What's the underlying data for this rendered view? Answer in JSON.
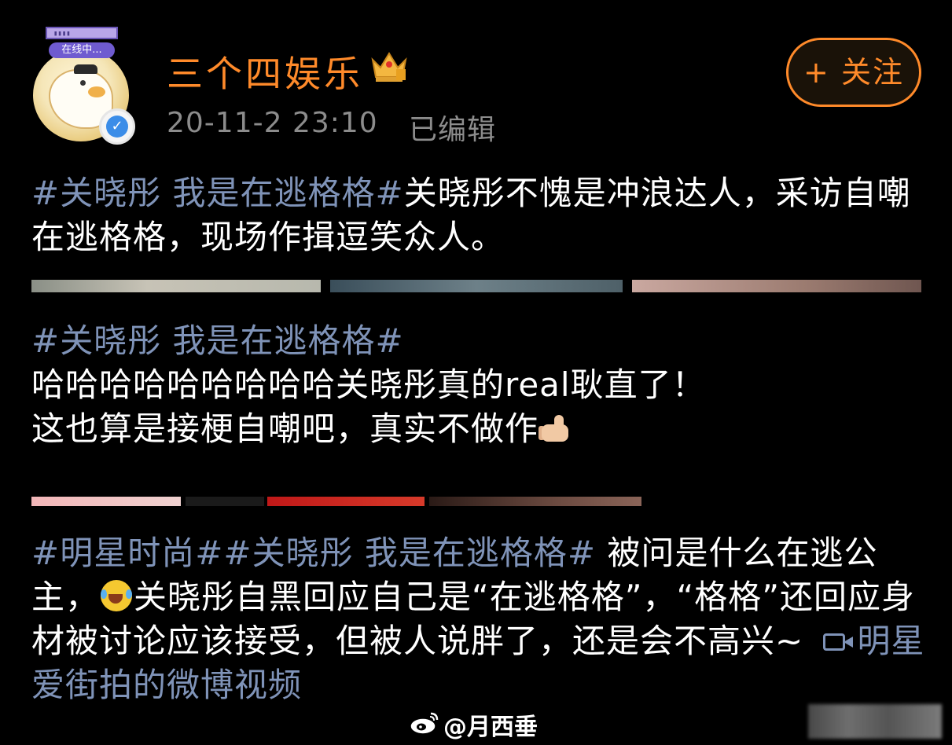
{
  "post": {
    "author": "三个四娱乐",
    "online_label": "在线中...",
    "time": "20-11-2 23:10",
    "edited": "已编辑",
    "follow_label": "+ 关注"
  },
  "paragraphs": [
    {
      "tag": "#关晓彤 我是在逃格格#",
      "text": "关晓彤不愧是冲浪达人，采访自嘲在逃格格，现场作揖逗笑众人。"
    },
    {
      "tag": "#关晓彤 我是在逃格格#",
      "line1": "哈哈哈哈哈哈哈哈哈关晓彤真的real耿直了！",
      "line2": "这也算是接梗自嘲吧，真实不做作"
    },
    {
      "tag": "#明星时尚##关晓彤 我是在逃格格#",
      "text_a": " 被问是什么在逃公主，",
      "text_b": "关晓彤自黑回应自己是“在逃格格”，“格格”还回应身材被讨论应该接受，但被人说胖了，还是会不高兴~ ",
      "video_link": "明星爱街拍的微博视频"
    }
  ],
  "icons": {
    "verify": "verified-badge-icon",
    "crown": "crown-icon",
    "thumb": "thumbs-up-emoji-icon",
    "laugh": "laughing-crying-emoji-icon",
    "video": "video-camera-icon",
    "weibo": "weibo-logo-icon"
  },
  "watermark": {
    "text": "@月西垂"
  },
  "colors": {
    "background": "#000000",
    "author": "#ff8a2a",
    "hashtag": "#7f93b8",
    "meta": "#8c8c8c"
  }
}
